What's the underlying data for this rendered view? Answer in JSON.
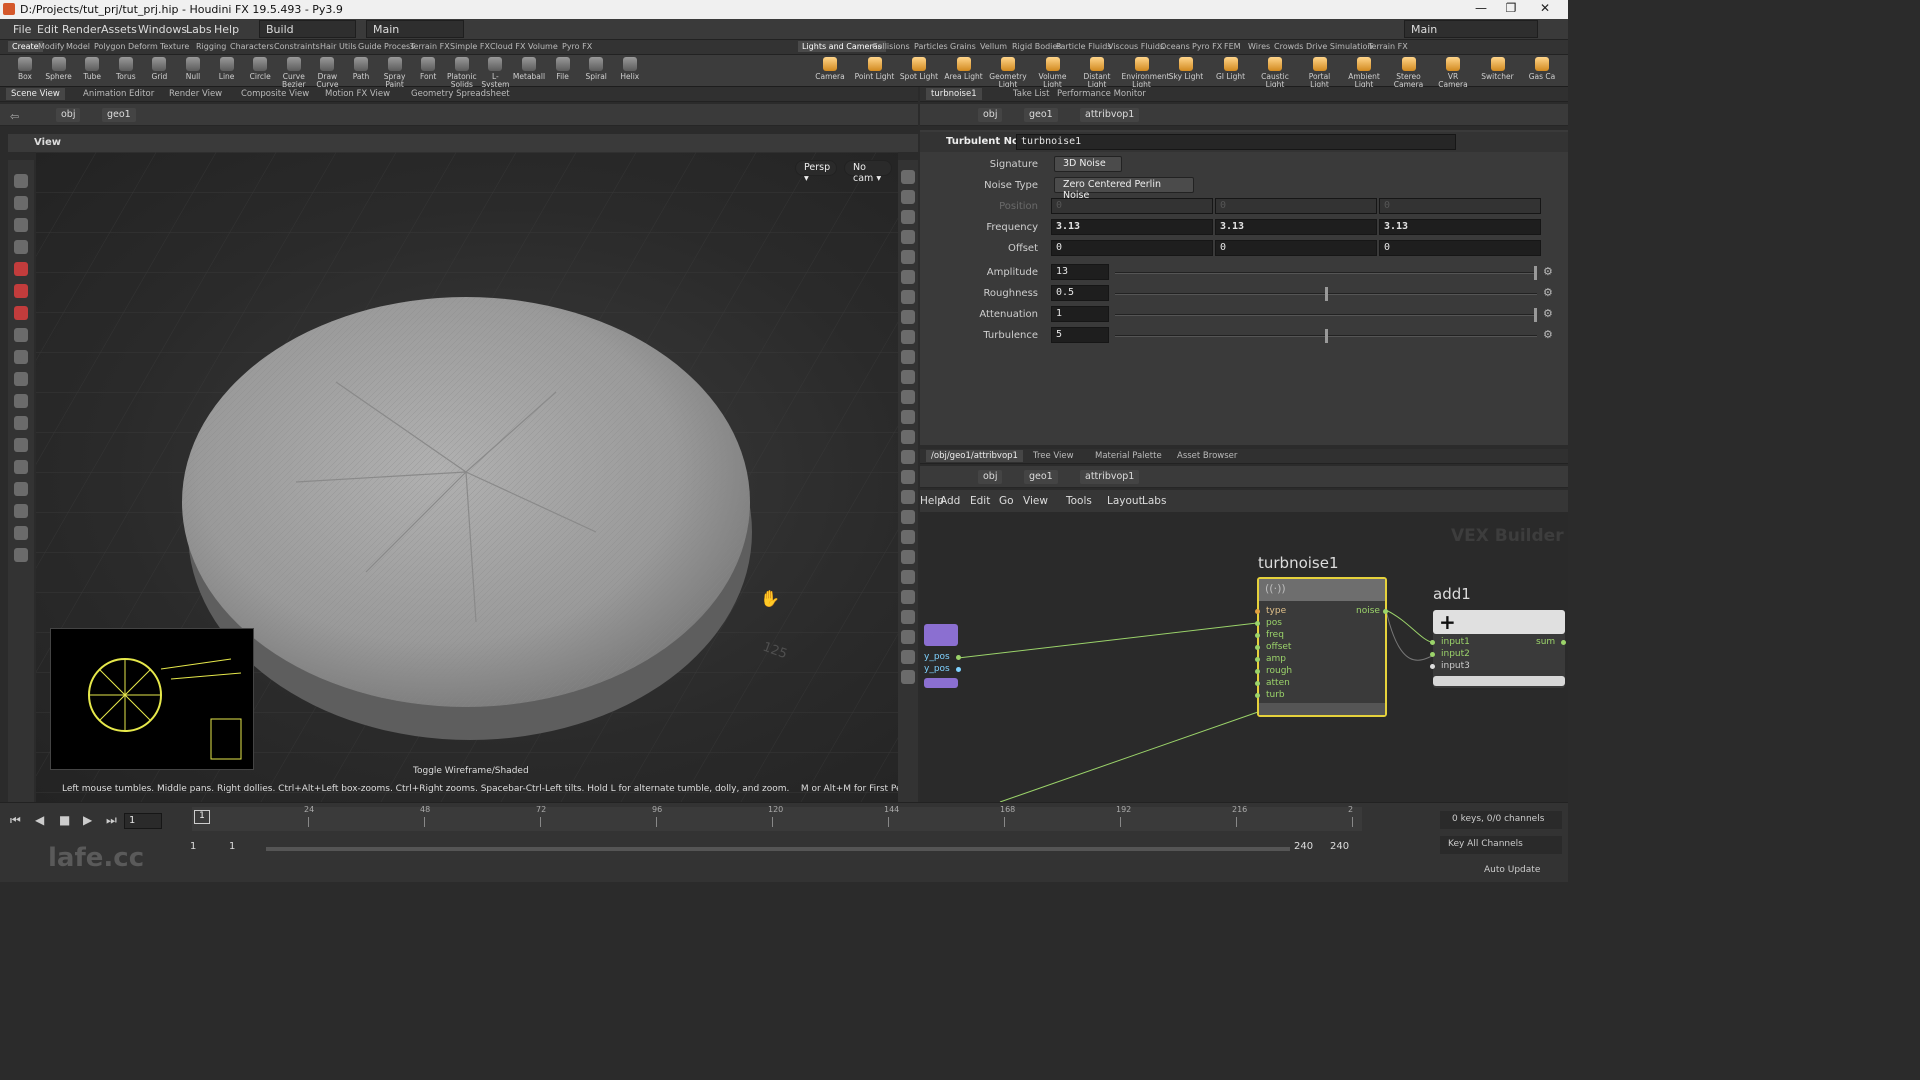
{
  "window": {
    "title": "D:/Projects/tut_prj/tut_prj.hip - Houdini FX 19.5.493 - Py3.9",
    "controls": [
      "—",
      "❐",
      "✕"
    ]
  },
  "menu": {
    "items": [
      "File",
      "Edit",
      "Render",
      "Assets",
      "Windows",
      "Labs",
      "Help"
    ],
    "desktop_left": "Build",
    "desktop_mid": "Main",
    "desktop_right": "Main"
  },
  "shelf_tabs_left": [
    "Create",
    "Modify",
    "Model",
    "Polygon",
    "Deform",
    "Texture",
    "Rigging",
    "Characters",
    "Constraints",
    "Hair Utils",
    "Guide Process",
    "Terrain FX",
    "Simple FX",
    "Cloud FX",
    "Volume",
    "Pyro FX"
  ],
  "shelf_tabs_right": [
    "Lights and Cameras",
    "Collisions",
    "Particles",
    "Grains",
    "Vellum",
    "Rigid Bodies",
    "Particle Fluids",
    "Viscous Fluids",
    "Oceans",
    "Pyro FX",
    "FEM",
    "Wires",
    "Crowds",
    "Drive Simulation",
    "Terrain FX"
  ],
  "tools_left": [
    "Box",
    "Sphere",
    "Tube",
    "Torus",
    "Grid",
    "Null",
    "Line",
    "Circle",
    "Curve Bezier",
    "Draw Curve",
    "Path",
    "Spray Paint",
    "Font",
    "Platonic Solids",
    "L-System",
    "Metaball",
    "File",
    "Spiral",
    "Helix"
  ],
  "tools_right": [
    "Camera",
    "Point Light",
    "Spot Light",
    "Area Light",
    "Geometry Light",
    "Volume Light",
    "Distant Light",
    "Environment Light",
    "Sky Light",
    "GI Light",
    "Caustic Light",
    "Portal Light",
    "Ambient Light",
    "Stereo Camera",
    "VR Camera",
    "Switcher",
    "Gas Ca"
  ],
  "left_pane_tabs": [
    "Scene View",
    "Animation Editor",
    "Render View",
    "Composite View",
    "Motion FX View",
    "Geometry Spreadsheet"
  ],
  "left_path": {
    "obj": "obj",
    "geo": "geo1"
  },
  "view_label": "View",
  "viewport": {
    "persp": "Persp ▾",
    "cam": "No cam ▾",
    "toggle_hint": "Toggle Wireframe/Shaded",
    "status": "Left mouse tumbles. Middle pans. Right dollies. Ctrl+Alt+Left box-zooms. Ctrl+Right zooms. Spacebar-Ctrl-Left tilts. Hold L for alternate tumble, dolly, and zoom.    M or Alt+M for First Person Navigation.",
    "grid_label": "125"
  },
  "param_tabs": [
    "turbnoise1",
    "Take List",
    "Performance Monitor"
  ],
  "param_path": {
    "obj": "obj",
    "geo": "geo1",
    "node": "attribvop1"
  },
  "param": {
    "type": "Turbulent Noise",
    "name": "turbnoise1",
    "signature_label": "Signature",
    "signature": "3D Noise",
    "noise_type_label": "Noise Type",
    "noise_type": "Zero Centered Perlin Noise",
    "position_label": "Position",
    "position": [
      "0",
      "0",
      "0"
    ],
    "frequency_label": "Frequency",
    "frequency": [
      "3.13",
      "3.13",
      "3.13"
    ],
    "offset_label": "Offset",
    "offset": [
      "0",
      "0",
      "0"
    ],
    "amplitude_label": "Amplitude",
    "amplitude": "13",
    "amplitude_frac": 1.0,
    "roughness_label": "Roughness",
    "roughness": "0.5",
    "roughness_frac": 0.5,
    "attenuation_label": "Attenuation",
    "attenuation": "1",
    "attenuation_frac": 1.0,
    "turbulence_label": "Turbulence",
    "turbulence": "5",
    "turbulence_frac": 0.5
  },
  "net_tabs": [
    "/obj/geo1/attribvop1",
    "Tree View",
    "Material Palette",
    "Asset Browser"
  ],
  "net_path": {
    "obj": "obj",
    "geo": "geo1",
    "node": "attribvop1"
  },
  "net_menu": [
    "Add",
    "Edit",
    "Go",
    "View",
    "Tools",
    "Layout",
    "Labs",
    "Help"
  ],
  "net_watermark": "VEX Builder",
  "nodes": {
    "turb": {
      "name": "turbnoise1",
      "inputs": [
        "type",
        "pos",
        "freq",
        "offset",
        "amp",
        "rough",
        "atten",
        "turb"
      ],
      "output": "noise"
    },
    "add": {
      "name": "add1",
      "inputs": [
        "input1",
        "input2",
        "input3"
      ],
      "output": "sum"
    },
    "left": {
      "outputs": [
        "y_pos",
        "y_pos"
      ]
    }
  },
  "timeline": {
    "ticks": [
      "24",
      "48",
      "72",
      "96",
      "120",
      "144",
      "168",
      "192",
      "216",
      "2"
    ],
    "frame": "1",
    "start": "1",
    "start2": "1",
    "end": "240",
    "end2": "240",
    "current_marker": "1",
    "keys": "0 keys, 0/0 channels",
    "key_all": "Key All Channels",
    "auto_update": "Auto Update"
  },
  "watermark": "lafe.cc"
}
